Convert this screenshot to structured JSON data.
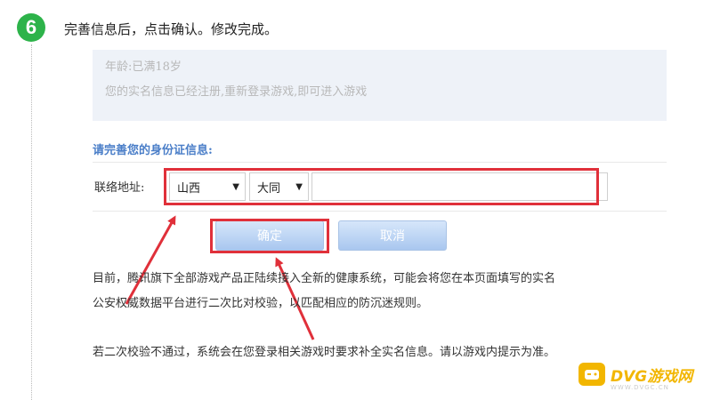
{
  "step": {
    "number": "6",
    "instruction": "完善信息后，点击确认。修改完成。"
  },
  "info_box": {
    "line1": "年龄:已满18岁",
    "line2": "您的实名信息已经注册,重新登录游戏,即可进入游戏"
  },
  "form": {
    "section_title": "请完善您的身份证信息:",
    "address_label": "联络地址:",
    "province": {
      "selected": "山西"
    },
    "city": {
      "selected": "大同"
    },
    "address_value": ""
  },
  "buttons": {
    "confirm": "确定",
    "cancel": "取消"
  },
  "notice": {
    "line1": "目前，腾讯旗下全部游戏产品正陆续接入全新的健康系统，可能会将您在本页面填写的实名",
    "line2": "公安权威数据平台进行二次比对校验，以匹配相应的防沉迷规则。",
    "line3": "若二次校验不通过，系统会在您登录相关游戏时要求补全实名信息。请以游戏内提示为准。"
  },
  "watermark": {
    "title": "DVG游戏网",
    "subtitle": "WWW.DVGC.CN"
  },
  "colors": {
    "badge_green": "#2db34a",
    "highlight_red": "#e0303a",
    "title_blue": "#4a7ec8",
    "button_blue": "#a9c7ef",
    "watermark_yellow": "#f2b600"
  }
}
